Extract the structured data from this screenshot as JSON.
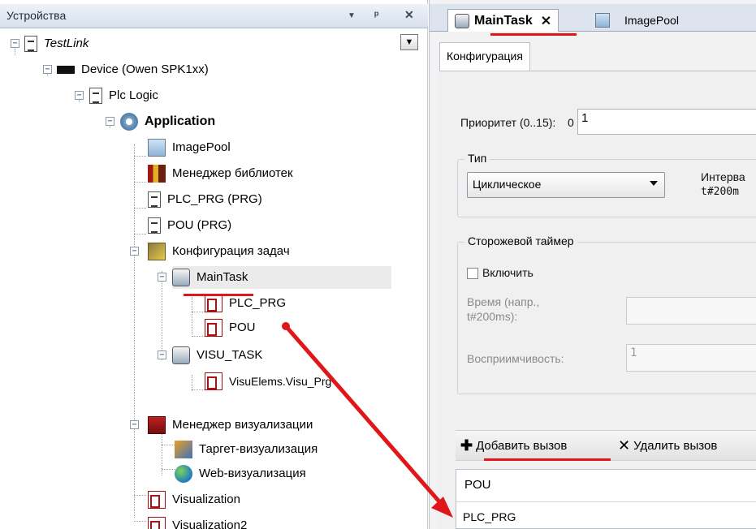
{
  "devices_panel": {
    "title": "Устройства",
    "pin_glyph": "ᵖ",
    "close_glyph": "✕",
    "dropdown_glyph": "▾"
  },
  "tree": {
    "project": "TestLink",
    "device": "Device (Owen SPK1xx)",
    "plc_logic": "Plc Logic",
    "application": "Application",
    "image_pool": "ImagePool",
    "library_manager": "Менеджер библиотек",
    "plc_prg": "PLC_PRG (PRG)",
    "pou": "POU (PRG)",
    "task_config": "Конфигурация задач",
    "main_task": "MainTask",
    "main_task_call_1": "PLC_PRG",
    "main_task_call_2": "POU",
    "visu_task": "VISU_TASK",
    "visu_task_call": "VisuElems.Visu_Prg",
    "visu_manager": "Менеджер визуализации",
    "target_visu": "Таргет-визуализация",
    "web_visu": "Web-визуализация",
    "visualization": "Visualization",
    "visualization2": "Visualization2"
  },
  "editor": {
    "tabs": [
      {
        "label": "MainTask",
        "active": true,
        "close": "✕"
      },
      {
        "label": "ImagePool",
        "active": false
      }
    ],
    "subtab": "Конфигурация",
    "priority_label": "Приоритет (0..15):",
    "priority_prefix": "0",
    "priority_value": "1",
    "type_group": "Тип",
    "type_value": "Циклическое",
    "interval_label_1": "Интерва",
    "interval_label_2": "t#200m",
    "watchdog_group": "Сторожевой таймер",
    "enable_label": "Включить",
    "enable_checked": false,
    "time_label_1": "Время (напр.,",
    "time_label_2": "t#200ms):",
    "time_value": "",
    "sensitivity_label": "Восприимчивость:",
    "sensitivity_value": "1",
    "add_call": "Добавить вызов",
    "remove_call": "Удалить вызов",
    "table_header": "POU",
    "table_rows": [
      "PLC_PRG"
    ]
  },
  "colors": {
    "annotation_red": "#e0161b",
    "selection": "#ebebeb"
  }
}
